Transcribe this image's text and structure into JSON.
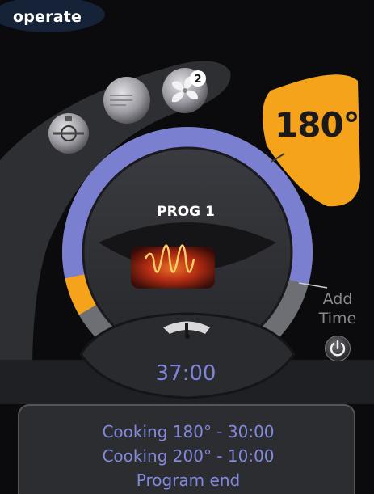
{
  "header": {
    "mode_label": "operate"
  },
  "temperature": {
    "display": "180°"
  },
  "program": {
    "name": "PROG 1"
  },
  "timer": {
    "display": "37:00"
  },
  "add_time": {
    "line1": "Add",
    "line2": "Time"
  },
  "function_icons": [
    {
      "icon": "steam-valve-icon"
    },
    {
      "icon": "heating-element-icon"
    },
    {
      "icon": "fan-icon",
      "badge": "2"
    }
  ],
  "program_steps": [
    {
      "text": "Cooking 180° - 30:00"
    },
    {
      "text": "Cooking 200° - 10:00"
    },
    {
      "text": "Program end"
    }
  ],
  "progress": {
    "fraction": 0.08
  },
  "colors": {
    "accent_orange": "#f5a31a",
    "ring_blue": "#7b7fd0",
    "text_blue": "#8389dd",
    "background": "#0b0b0d"
  }
}
